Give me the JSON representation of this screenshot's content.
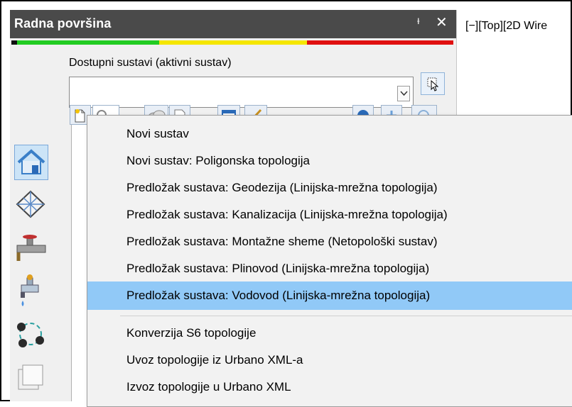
{
  "palette": {
    "title": "Radna površina",
    "pin_glyph": "ᵻ",
    "close_glyph": "✕",
    "status_colors": [
      "#111111",
      "#22cc22",
      "#f5e600",
      "#e01010"
    ],
    "systems_label": "Dostupni sustavi (aktivni sustav)",
    "systems_value": ""
  },
  "viewport": {
    "label": "[−][Top][2D Wire"
  },
  "toolbar_icons": [
    "new-system-icon",
    "search-icon",
    "layers-icon",
    "document-icon",
    "list-icon",
    "brush-icon",
    "info-icon",
    "refresh-icon",
    "help-icon"
  ],
  "sidebar_icons": [
    "house-icon",
    "grid-surface-icon",
    "pipe-valve-icon",
    "water-tap-icon",
    "network-nodes-icon",
    "documents-icon"
  ],
  "menu": {
    "items": [
      "Novi sustav",
      "Novi sustav: Poligonska topologija",
      "Predložak sustava: Geodezija (Linijska-mrežna topologija)",
      "Predložak sustava: Kanalizacija (Linijska-mrežna topologija)",
      "Predložak sustava: Montažne sheme (Netopološki sustav)",
      "Predložak sustava: Plinovod (Linijska-mrežna topologija)",
      "Predložak sustava: Vodovod (Linijska-mrežna topologija)",
      "Konverzija S6 topologije",
      "Uvoz topologije iz Urbano XML-a",
      "Izvoz topologije u Urbano XML"
    ],
    "highlighted_index": 6,
    "highlight_color": "#91c9f7"
  }
}
